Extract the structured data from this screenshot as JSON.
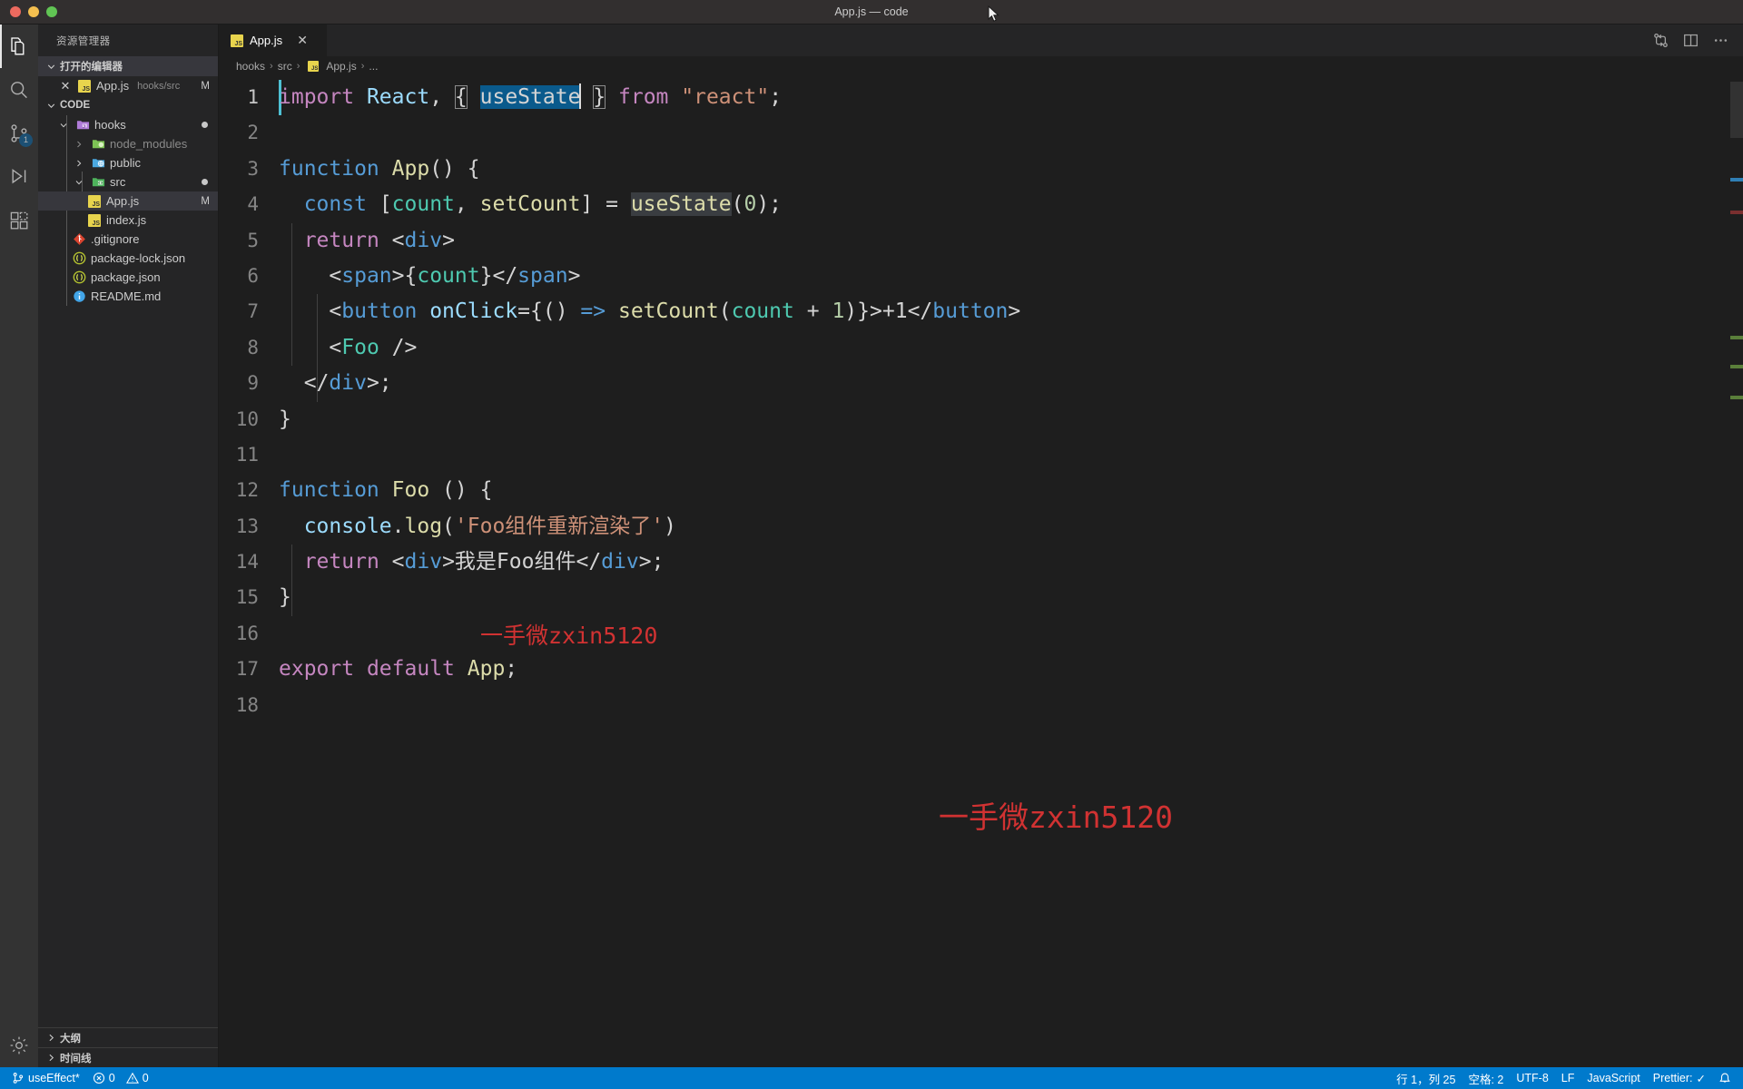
{
  "window": {
    "title": "App.js — code",
    "traffic_lights": [
      "close",
      "minimize",
      "maximize"
    ]
  },
  "activity_bar": {
    "items": [
      {
        "name": "explorer",
        "icon": "files-icon",
        "active": true,
        "badge": null
      },
      {
        "name": "search",
        "icon": "search-icon",
        "active": false,
        "badge": null
      },
      {
        "name": "source-control",
        "icon": "source-control-icon",
        "active": false,
        "badge": "1"
      },
      {
        "name": "run-and-debug",
        "icon": "run-debug-icon",
        "active": false,
        "badge": null
      },
      {
        "name": "extensions",
        "icon": "extensions-icon",
        "active": false,
        "badge": null
      }
    ],
    "bottom_items": [
      {
        "name": "manage-settings",
        "icon": "gear-icon"
      }
    ]
  },
  "sidebar": {
    "title": "资源管理器",
    "open_editors": {
      "label": "打开的编辑器",
      "expanded": true,
      "items": [
        {
          "name": "App.js",
          "path": "hooks/src",
          "status": "M",
          "icon": "js-file-icon",
          "selected": false
        }
      ]
    },
    "workspace": {
      "label": "CODE",
      "expanded": true,
      "tree": [
        {
          "label": "hooks",
          "depth": 1,
          "type": "folder",
          "icon": "folder-hooks-icon",
          "expanded": true,
          "arrow": "down",
          "dirty": true,
          "selected": false
        },
        {
          "label": "node_modules",
          "depth": 2,
          "type": "folder",
          "icon": "folder-node-icon",
          "expanded": false,
          "arrow": "right",
          "dirty": false,
          "selected": false,
          "dim": true
        },
        {
          "label": "public",
          "depth": 2,
          "type": "folder",
          "icon": "folder-public-icon",
          "expanded": false,
          "arrow": "right",
          "dirty": false,
          "selected": false
        },
        {
          "label": "src",
          "depth": 2,
          "type": "folder",
          "icon": "folder-src-icon",
          "expanded": true,
          "arrow": "down",
          "dirty": true,
          "selected": false
        },
        {
          "label": "App.js",
          "depth": 3,
          "type": "file",
          "icon": "js-file-icon",
          "status": "M",
          "selected": true
        },
        {
          "label": "index.js",
          "depth": 3,
          "type": "file",
          "icon": "js-file-icon",
          "selected": false
        },
        {
          "label": ".gitignore",
          "depth": 2,
          "type": "file",
          "icon": "git-file-icon",
          "selected": false
        },
        {
          "label": "package-lock.json",
          "depth": 2,
          "type": "file",
          "icon": "json-file-icon",
          "selected": false
        },
        {
          "label": "package.json",
          "depth": 2,
          "type": "file",
          "icon": "json-file-icon",
          "selected": false
        },
        {
          "label": "README.md",
          "depth": 2,
          "type": "file",
          "icon": "markdown-file-icon",
          "selected": false
        }
      ]
    },
    "bottom_sections": [
      {
        "label": "大纲",
        "expanded": false
      },
      {
        "label": "时间线",
        "expanded": false
      }
    ]
  },
  "editor": {
    "tabs": [
      {
        "label": "App.js",
        "icon": "js-file-icon",
        "active": true,
        "close_icon": "close-icon"
      }
    ],
    "tab_actions": [
      {
        "name": "split-editor-vertical",
        "icon": "split-editor-icon"
      },
      {
        "name": "open-changes",
        "icon": "compare-changes-icon"
      },
      {
        "name": "more-actions",
        "icon": "ellipsis-icon"
      }
    ],
    "breadcrumb": [
      "hooks",
      "src",
      "App.js",
      "..."
    ],
    "breadcrumb_separator": "›",
    "lines": [
      {
        "n": 1,
        "indent": 0
      },
      {
        "n": 2,
        "indent": 0
      },
      {
        "n": 3,
        "indent": 0
      },
      {
        "n": 4,
        "indent": 1
      },
      {
        "n": 5,
        "indent": 1
      },
      {
        "n": 6,
        "indent": 2
      },
      {
        "n": 7,
        "indent": 2
      },
      {
        "n": 8,
        "indent": 2
      },
      {
        "n": 9,
        "indent": 1
      },
      {
        "n": 10,
        "indent": 0
      },
      {
        "n": 11,
        "indent": 0
      },
      {
        "n": 12,
        "indent": 0
      },
      {
        "n": 13,
        "indent": 1
      },
      {
        "n": 14,
        "indent": 1
      },
      {
        "n": 15,
        "indent": 0
      },
      {
        "n": 16,
        "indent": 0
      },
      {
        "n": 17,
        "indent": 0
      },
      {
        "n": 18,
        "indent": 0
      }
    ],
    "source_text": [
      "import React, { useState } from \"react\";",
      "",
      "function App() {",
      "  const [count, setCount] = useState(0);",
      "  return <div>",
      "    <span>{count}</span>",
      "    <button onClick={() => setCount(count + 1)}>+1</button>",
      "    <Foo />",
      "  </div>;",
      "}",
      "",
      "function Foo () {",
      "  console.log('Foo组件重新渲染了')",
      "  return <div>我是Foo组件</div>;",
      "}",
      "",
      "export default App;",
      ""
    ],
    "selection": {
      "text": "useState",
      "line": 1
    },
    "occurrence_highlight": {
      "text": "useState",
      "line": 4
    },
    "watermarks": [
      {
        "text": "一手微zxin5120",
        "size": "small"
      },
      {
        "text": "一手微zxin5120",
        "size": "large"
      }
    ],
    "watermark_color": "#d13232"
  },
  "status_bar": {
    "branch": "useEffect*",
    "branch_icon": "source-control-icon",
    "errors": "0",
    "errors_icon": "error-icon",
    "warnings": "0",
    "warnings_icon": "warning-icon",
    "cursor_position": "行 1，列 25",
    "indentation": "空格: 2",
    "encoding": "UTF-8",
    "eol": "LF",
    "language": "JavaScript",
    "formatter": "Prettier:",
    "formatter_status": "✓",
    "notifications_icon": "bell-icon"
  },
  "colors": {
    "accent": "#007acc",
    "sidebar_bg": "#252526",
    "editor_bg": "#1e1e1e",
    "activity_bg": "#333333",
    "titlebar_bg": "#322f2f",
    "selection": "#0a5a8c"
  }
}
